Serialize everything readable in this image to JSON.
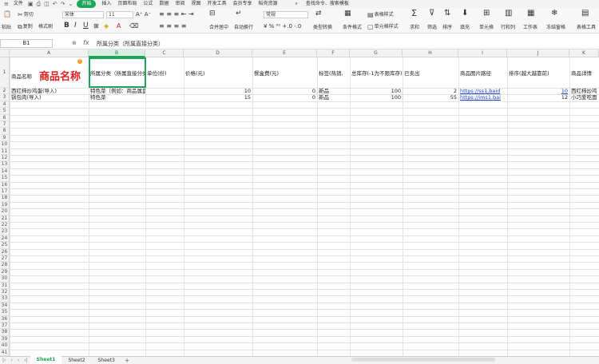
{
  "menubar": {
    "file": "文件",
    "tabs": [
      "开始",
      "插入",
      "页面布局",
      "公式",
      "数据",
      "审阅",
      "视图",
      "开发工具",
      "会员专享",
      "稻壳资源"
    ],
    "active_tab_index": 0,
    "search_placeholder": "查找命令、搜索模板"
  },
  "ribbon": {
    "paste": "粘贴",
    "cut": "剪切",
    "copy": "复制",
    "format_painter": "格式刷",
    "font_name": "宋体",
    "font_size": "11",
    "merge_center": "合并居中",
    "wrap_text": "自动换行",
    "number_format": "常规",
    "type_convert": "类型转换",
    "cond_format": "条件格式",
    "table_style": "表格样式",
    "cell_style": "单元格样式",
    "sum": "求和",
    "filter": "筛选",
    "sort": "排序",
    "fill": "填充",
    "cells": "单元格",
    "rows_cols": "行和列",
    "worksheet": "工作表",
    "freeze": "冻结窗格",
    "table_tools": "表格工具"
  },
  "formula_bar": {
    "cell_ref": "B1",
    "fx": "fx",
    "content": "所属分类（所属直接分类）"
  },
  "columns": [
    "A",
    "B",
    "C",
    "D",
    "E",
    "F",
    "G",
    "H",
    "I",
    "J",
    "K"
  ],
  "selected_column": "B",
  "header_row": {
    "A": "商品名称",
    "A_title": "商品名称",
    "B": "所属分类（所属直接分类）",
    "C": "单位(份)",
    "D": "价格(元)",
    "E": "餐盒费(元)",
    "F": "标签(热销,",
    "G": "总库存(-1为不限库存)",
    "H": "已卖出",
    "I": "商品图片路径",
    "J": "排序(越大越靠前)",
    "K": "商品详情"
  },
  "rows": [
    {
      "A": "西红柿炒鸡蛋(导入)",
      "B": "特色菜（例如：商品属盘",
      "C": "",
      "D": "10",
      "E": "0",
      "F": "新品",
      "G": "100",
      "H": "2",
      "I": "https://ss1.baid",
      "J": "10",
      "K": "西红柿炒鸡"
    },
    {
      "A": "锅包肉(导入)",
      "B": "特色菜",
      "C": "",
      "D": "15",
      "E": "0",
      "F": "新品",
      "G": "100",
      "H": "55",
      "I": "https://ims1.bai",
      "J": "12",
      "K": "小巧爱吃面"
    }
  ],
  "row_numbers": [
    "1",
    "2",
    "3",
    "4",
    "5",
    "6",
    "7",
    "8",
    "9",
    "10",
    "11",
    "12",
    "13",
    "14",
    "15",
    "16",
    "17",
    "18",
    "19",
    "20",
    "21",
    "22",
    "23",
    "24",
    "25",
    "26",
    "27",
    "28",
    "29",
    "30",
    "31",
    "32",
    "33",
    "34",
    "35",
    "36",
    "37",
    "38",
    "39",
    "40",
    "41"
  ],
  "sheets": [
    "Sheet1",
    "Sheet2",
    "Sheet3"
  ],
  "active_sheet_index": 0,
  "colors": {
    "accent": "#1fa55a",
    "title_red": "#e02020",
    "link": "#1a3fc4"
  }
}
